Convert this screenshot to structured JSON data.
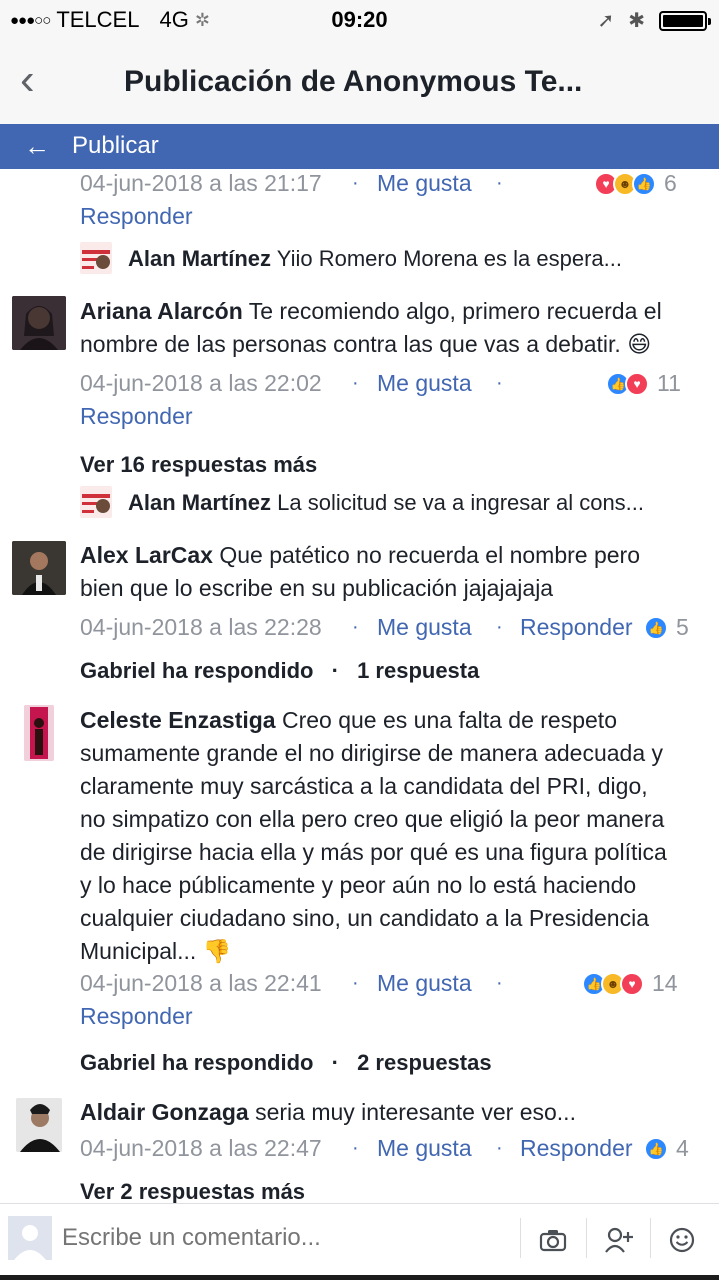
{
  "status_bar": {
    "signal": "●●●○○",
    "carrier": "TELCEL",
    "network": "4G",
    "activity_glyph": "✲",
    "time": "09:20",
    "location_glyph": "➚",
    "bluetooth_glyph": "✱"
  },
  "nav": {
    "back_glyph": "‹",
    "title": "Publicación de Anonymous Te..."
  },
  "publish_bar": {
    "arrow": "←",
    "label": "Publicar"
  },
  "comments": [
    {
      "timestamp": "04-jun-2018 a las 21:17",
      "like_label": "Me gusta",
      "reply_label": "Responder",
      "reactions": [
        "love",
        "haha",
        "like"
      ],
      "reaction_count": "6",
      "reply_preview": {
        "author": "Alan Martínez",
        "text": "Yiio Romero Morena es la espera..."
      }
    },
    {
      "author": "Ariana Alarcón",
      "line1": "Te recomiendo algo, primero recuerda el",
      "line2": "nombre de las personas contra las que vas a debatir. 😄",
      "timestamp": "04-jun-2018 a las 22:02",
      "like_label": "Me gusta",
      "reply_label": "Responder",
      "reactions": [
        "like",
        "love"
      ],
      "reaction_count": "11",
      "more_replies": "Ver 16 respuestas más",
      "reply_preview": {
        "author": "Alan Martínez",
        "text": "La solicitud se va a ingresar al cons..."
      }
    },
    {
      "author": "Alex LarCax",
      "line1": "Que patético no recuerda el nombre pero",
      "line2": "bien que lo escribe en su publicación jajajajaja",
      "timestamp": "04-jun-2018 a las 22:28",
      "like_label": "Me gusta",
      "reply_label": "Responder",
      "reactions": [
        "like"
      ],
      "reaction_count": "5",
      "replied_by": "Gabriel ha respondido",
      "replies_count": "1 respuesta"
    },
    {
      "author": "Celeste Enzastiga",
      "line1": "Creo que es una falta de respeto",
      "lines": [
        "sumamente grande el no dirigirse de manera adecuada y",
        "claramente muy sarcástica  a la candidata del PRI, digo,",
        "no simpatizo con ella pero creo que eligió la peor manera",
        "de dirigirse hacia ella y más por qué es una figura política",
        "y lo hace públicamente y peor aún no lo está haciendo",
        "cualquier ciudadano sino, un candidato a la Presidencia",
        "Municipal... 👎"
      ],
      "timestamp": "04-jun-2018 a las 22:41",
      "like_label": "Me gusta",
      "reply_label": "Responder",
      "reactions": [
        "like",
        "haha",
        "love"
      ],
      "reaction_count": "14",
      "replied_by": "Gabriel ha respondido",
      "replies_count": "2 respuestas"
    },
    {
      "author": "Aldair Gonzaga",
      "line1": "seria muy interesante ver eso...",
      "timestamp": "04-jun-2018 a las 22:47",
      "like_label": "Me gusta",
      "reply_label": "Responder",
      "reactions": [
        "like"
      ],
      "reaction_count": "4",
      "more_replies": "Ver 2 respuestas más"
    }
  ],
  "composer": {
    "placeholder": "Escribe un comentario...",
    "icons": [
      "camera-icon",
      "add-friend-icon",
      "emoji-icon"
    ]
  },
  "colors": {
    "brand_blue": "#4267b2",
    "meta_gray": "#90949c",
    "bar_gray": "#f7f7f7"
  }
}
